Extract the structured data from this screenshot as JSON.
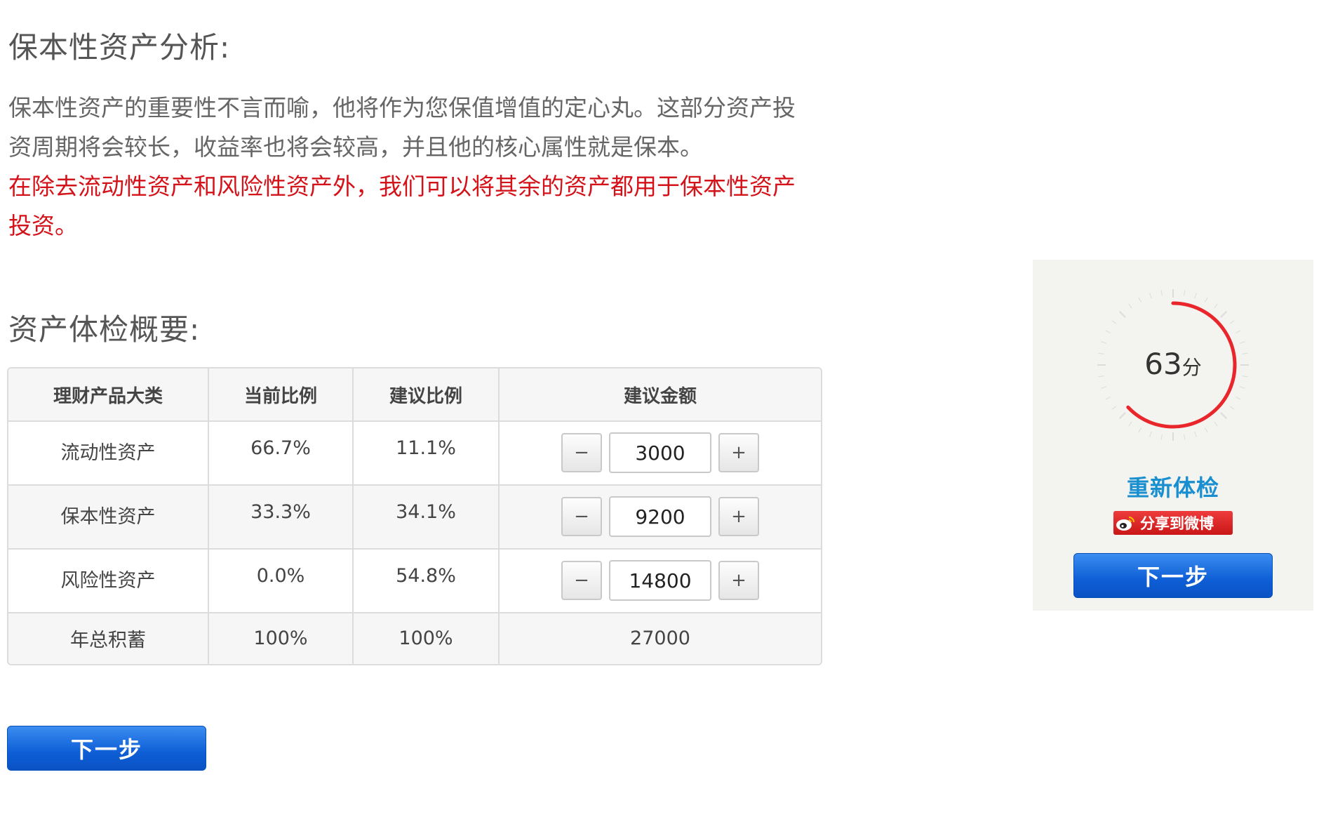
{
  "sections": {
    "preserve_title": "保本性资产分析:",
    "preserve_desc": "保本性资产的重要性不言而喻，他将作为您保值增值的定心丸。这部分资产投资周期将会较长，收益率也将会较高，并且他的核心属性就是保本。",
    "preserve_note": "在除去流动性资产和风险性资产外，我们可以将其余的资产都用于保本性资产投资。",
    "summary_title": "资产体检概要:"
  },
  "table": {
    "headers": [
      "理财产品大类",
      "当前比例",
      "建议比例",
      "建议金额"
    ],
    "rows": [
      {
        "category": "流动性资产",
        "current": "66.7%",
        "suggested": "11.1%",
        "amount": "3000"
      },
      {
        "category": "保本性资产",
        "current": "33.3%",
        "suggested": "34.1%",
        "amount": "9200"
      },
      {
        "category": "风险性资产",
        "current": "0.0%",
        "suggested": "54.8%",
        "amount": "14800"
      }
    ],
    "total": {
      "category": "年总积蓄",
      "current": "100%",
      "suggested": "100%",
      "amount": "27000"
    },
    "minus_label": "−",
    "plus_label": "+"
  },
  "buttons": {
    "next_label": "下一步"
  },
  "side_panel": {
    "score": "63",
    "score_unit": "分",
    "score_fraction": 0.63,
    "recheck_label": "重新体检",
    "weibo_label": "分享到微博",
    "next_label": "下一步"
  },
  "colors": {
    "accent_blue": "#0e5ed6",
    "link_blue": "#1a8fd0",
    "alert_red": "#d4121a",
    "gauge_red": "#e8262c"
  }
}
